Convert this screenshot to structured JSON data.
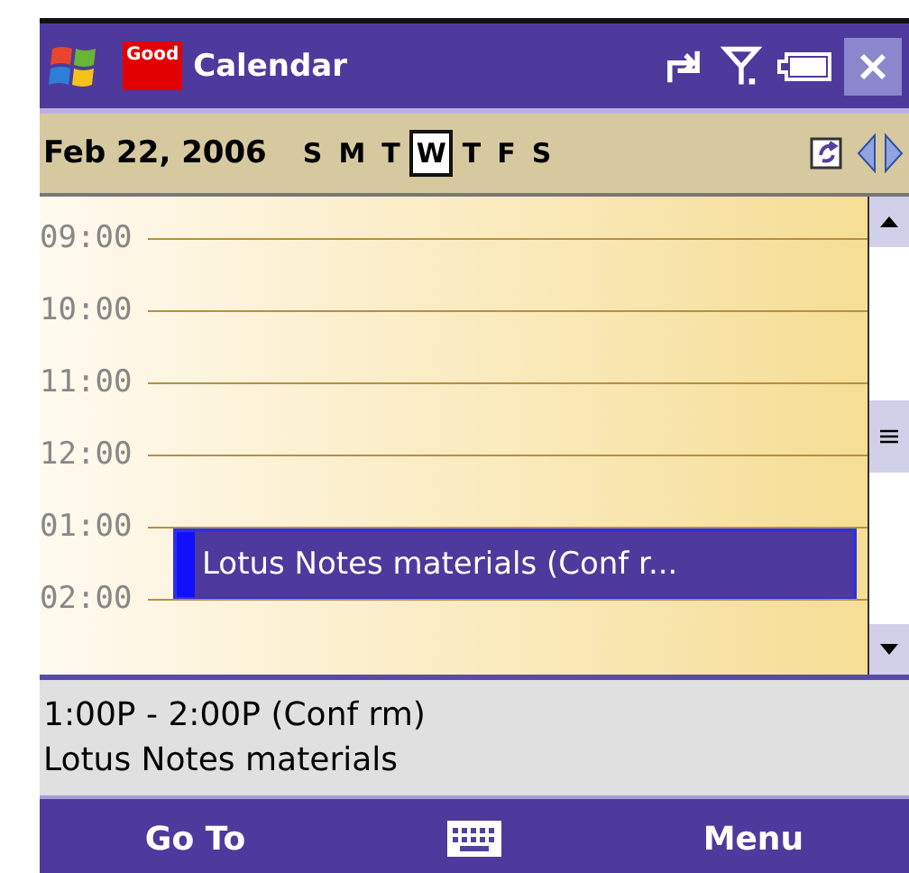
{
  "title_bar": {
    "logo_text": "Good",
    "title": "Calendar"
  },
  "date_bar": {
    "date": "Feb 22, 2006",
    "days": [
      {
        "label": "S",
        "selected": false
      },
      {
        "label": "M",
        "selected": false
      },
      {
        "label": "T",
        "selected": false
      },
      {
        "label": "W",
        "selected": true
      },
      {
        "label": "T",
        "selected": false
      },
      {
        "label": "F",
        "selected": false
      },
      {
        "label": "S",
        "selected": false
      }
    ]
  },
  "hours": [
    {
      "time": "09:00"
    },
    {
      "time": "10:00"
    },
    {
      "time": "11:00"
    },
    {
      "time": "12:00"
    },
    {
      "time": "01:00",
      "appointment": "Lotus Notes materials (Conf r..."
    },
    {
      "time": "02:00"
    }
  ],
  "details": {
    "time": "1:00P - 2:00P  (Conf rm)",
    "subject": "Lotus Notes materials"
  },
  "softkeys": {
    "left": "Go To",
    "right": "Menu"
  }
}
